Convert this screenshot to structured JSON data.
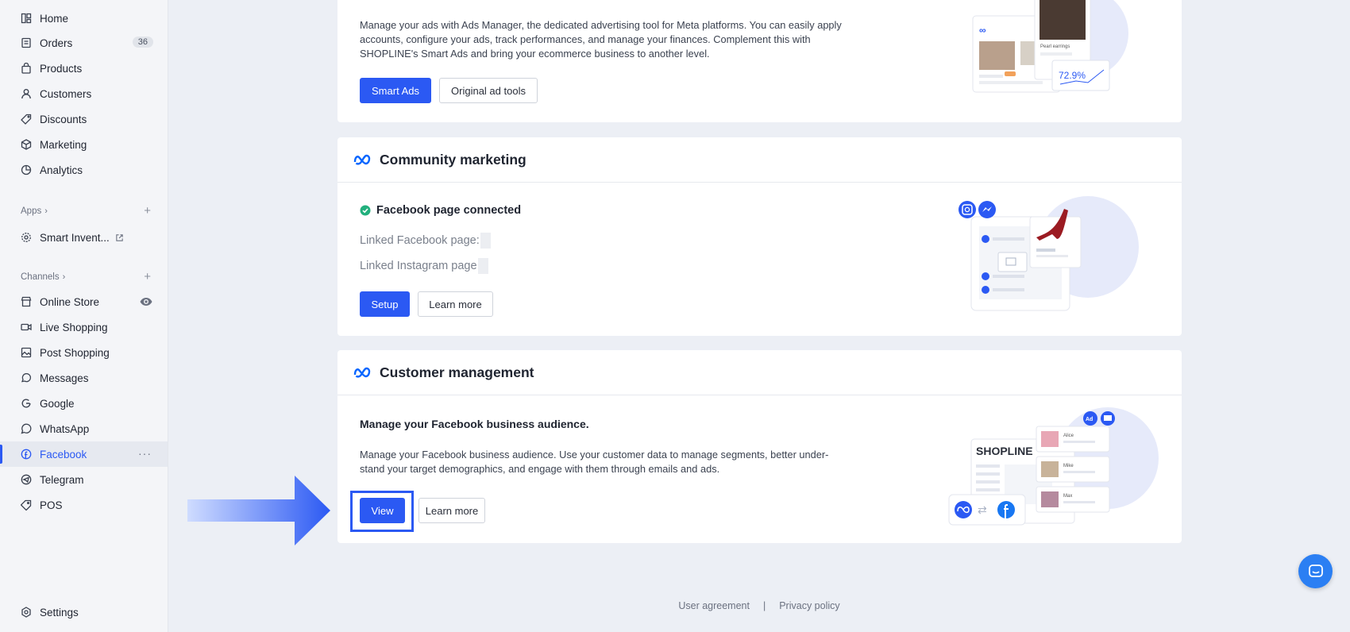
{
  "sidebar": {
    "items": [
      {
        "label": "Home",
        "icon": "home-icon"
      },
      {
        "label": "Orders",
        "icon": "orders-icon",
        "badge": "36"
      },
      {
        "label": "Products",
        "icon": "bag-icon"
      },
      {
        "label": "Customers",
        "icon": "person-icon"
      },
      {
        "label": "Discounts",
        "icon": "tag-icon"
      },
      {
        "label": "Marketing",
        "icon": "cube-icon"
      },
      {
        "label": "Analytics",
        "icon": "pie-icon"
      }
    ],
    "apps_heading": "Apps",
    "apps": [
      {
        "label": "Smart Invent...",
        "icon": "gear-icon"
      }
    ],
    "channels_heading": "Channels",
    "channels": [
      {
        "label": "Online Store",
        "icon": "store-icon"
      },
      {
        "label": "Live Shopping",
        "icon": "camera-icon"
      },
      {
        "label": "Post Shopping",
        "icon": "image-icon"
      },
      {
        "label": "Messages",
        "icon": "chat-icon"
      },
      {
        "label": "Google",
        "icon": "google-icon"
      },
      {
        "label": "WhatsApp",
        "icon": "whatsapp-icon"
      },
      {
        "label": "Facebook",
        "icon": "facebook-icon"
      },
      {
        "label": "Telegram",
        "icon": "telegram-icon"
      },
      {
        "label": "POS",
        "icon": "pos-icon"
      }
    ],
    "settings_label": "Settings"
  },
  "ads_card": {
    "description": "Manage your ads with Ads Manager, the dedicated advertising tool for Meta platforms. You can easily apply accounts, configure your ads, track performances, and manage your finances. Complement this with SHOPLINE's Smart Ads and bring your ecommerce business to another level.",
    "primary_button": "Smart Ads",
    "secondary_button": "Original ad tools",
    "illustration": {
      "stat": "72.9%",
      "product": "Pearl earrings"
    }
  },
  "community_card": {
    "title": "Community marketing",
    "status": "Facebook page connected",
    "linked_facebook": "Linked Facebook page:",
    "linked_instagram": "Linked Instagram page",
    "primary_button": "Setup",
    "secondary_button": "Learn more"
  },
  "customer_card": {
    "title": "Customer management",
    "heading": "Manage your Facebook business audience.",
    "description": "Manage your Facebook business audience. Use your customer data to manage segments, better under-stand your target demographics, and engage with them through emails and ads.",
    "primary_button": "View",
    "secondary_button": "Learn more",
    "illustration": {
      "brand": "SHOPLINE",
      "names": [
        "Alice",
        "Mike",
        "Max"
      ],
      "badge": "Ad"
    }
  },
  "footer": {
    "user_agreement": "User agreement",
    "separator": "|",
    "privacy_policy": "Privacy policy"
  },
  "colors": {
    "accent": "#2b59f3",
    "success": "#22b07d"
  }
}
